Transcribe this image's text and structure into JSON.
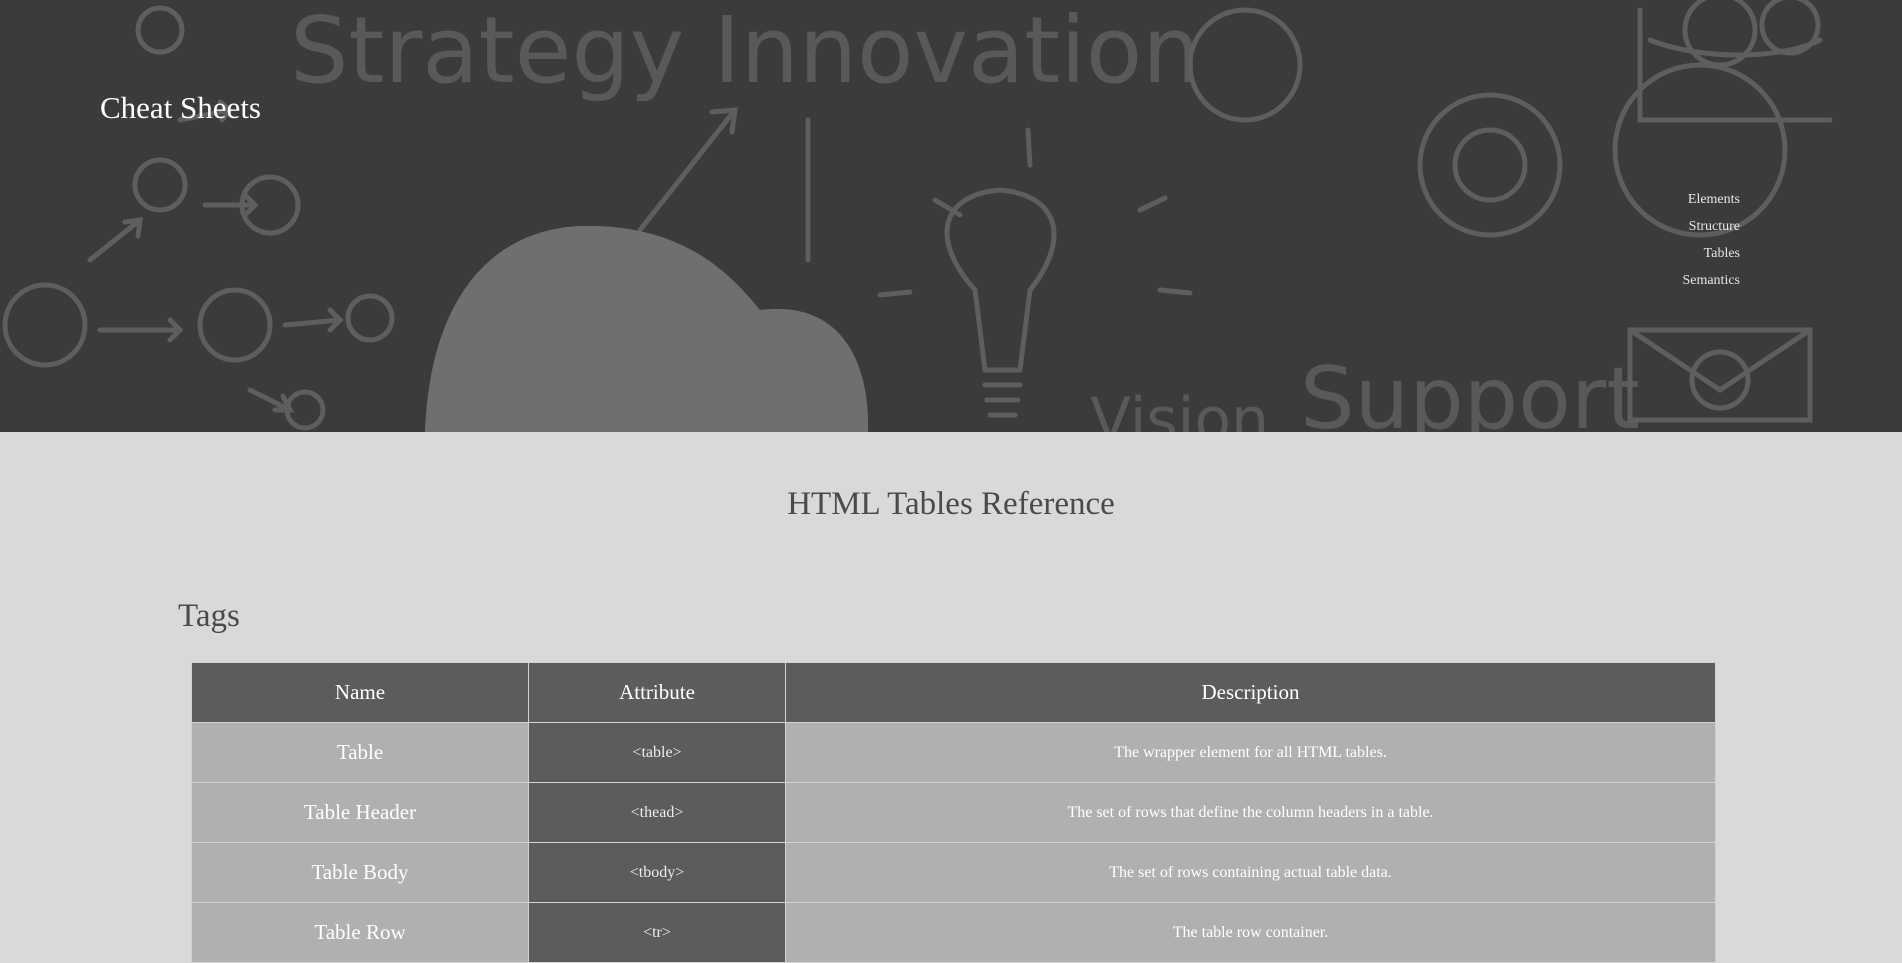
{
  "header": {
    "site_title": "Cheat Sheets",
    "nav": [
      {
        "label": "Elements"
      },
      {
        "label": "Structure"
      },
      {
        "label": "Tables"
      },
      {
        "label": "Semantics"
      }
    ],
    "background_words": [
      "Strategy Innovation",
      "Support",
      "Vision"
    ]
  },
  "main": {
    "page_heading": "HTML Tables Reference",
    "section_heading": "Tags",
    "table": {
      "columns": [
        "Name",
        "Attribute",
        "Description"
      ],
      "rows": [
        {
          "name": "Table",
          "attribute": "<table>",
          "description": "The wrapper element for all HTML tables."
        },
        {
          "name": "Table Header",
          "attribute": "<thead>",
          "description": "The set of rows that define the column headers in a table."
        },
        {
          "name": "Table Body",
          "attribute": "<tbody>",
          "description": "The set of rows containing actual table data."
        },
        {
          "name": "Table Row",
          "attribute": "<tr>",
          "description": "The table row container."
        }
      ]
    }
  },
  "colors": {
    "page_background": "#d9d9d9",
    "hero_background": "#3b3b3b",
    "header_cell": "#5c5c5c",
    "light_cell": "#b0b0b0",
    "heading_text": "#4a4a4a"
  }
}
